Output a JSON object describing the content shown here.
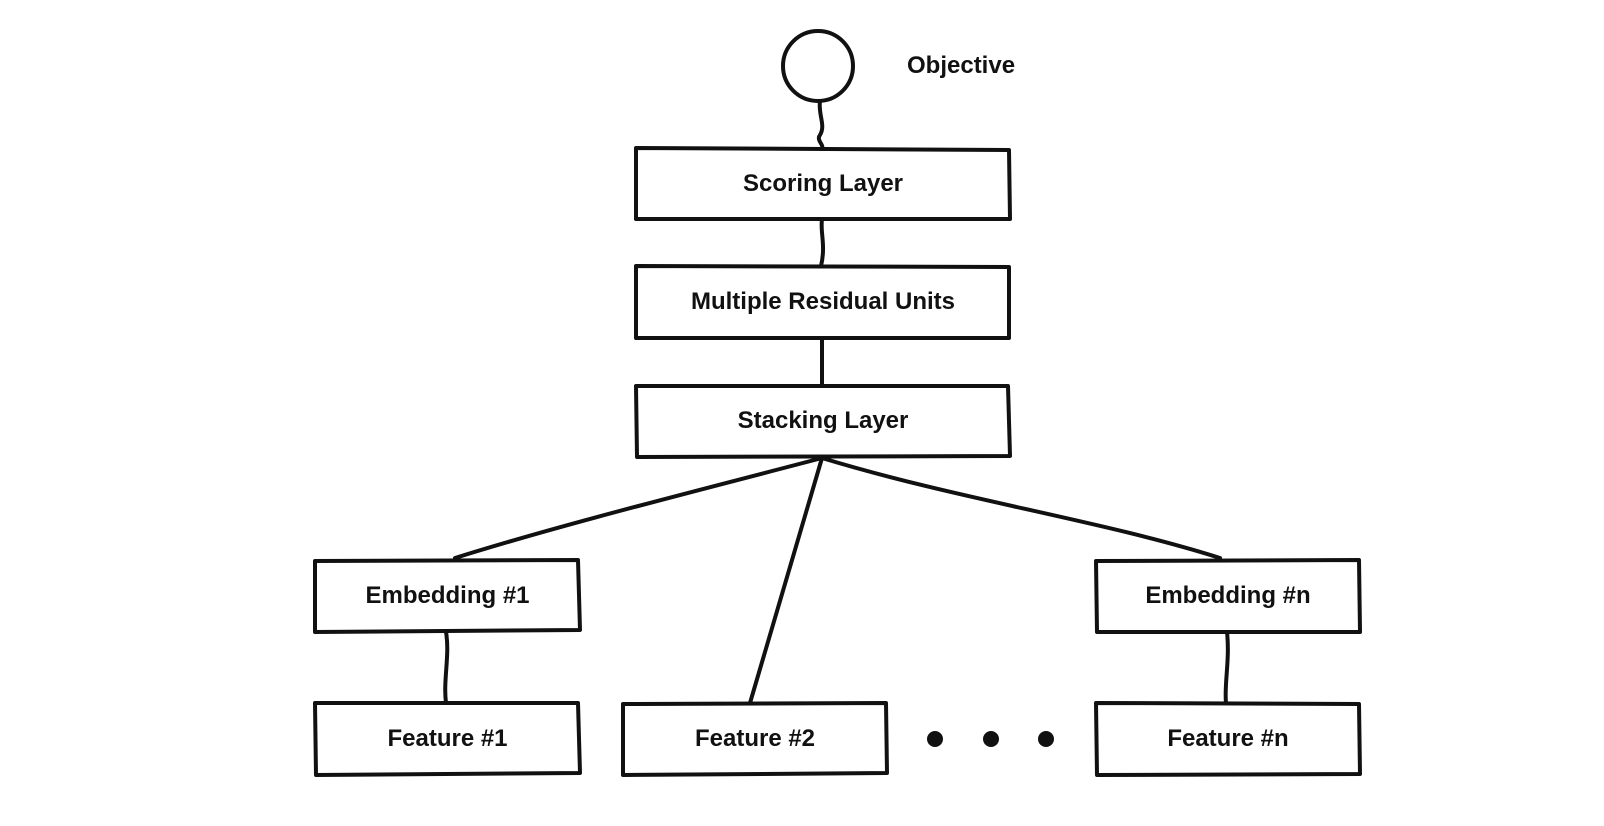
{
  "objective_label": "Objective",
  "layers": {
    "scoring": "Scoring Layer",
    "residual": "Multiple Residual Units",
    "stacking": "Stacking Layer"
  },
  "embeddings": [
    "Embedding #1",
    "Embedding #n"
  ],
  "features": [
    "Feature #1",
    "Feature #2",
    "Feature #n"
  ],
  "stroke_color": "#111111"
}
